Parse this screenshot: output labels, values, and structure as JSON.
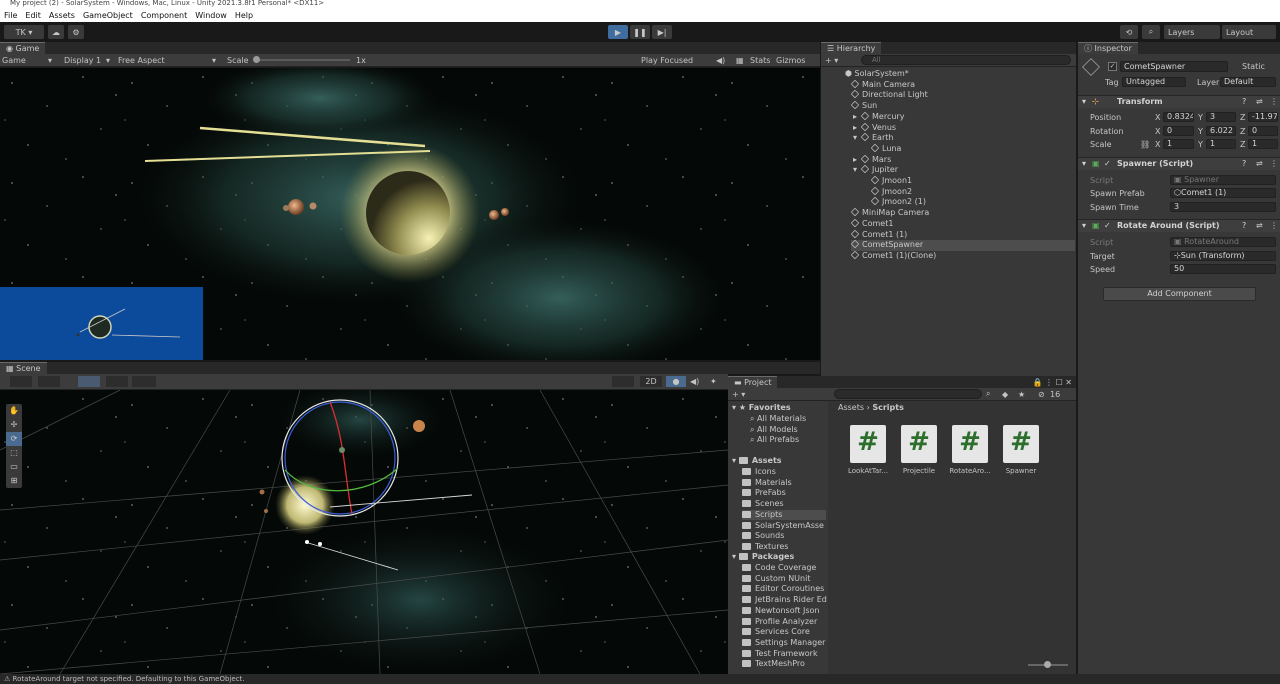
{
  "window": {
    "title": "My project (2) - SolarSystem - Windows, Mac, Linux - Unity 2021.3.8f1 Personal* <DX11>"
  },
  "menu": [
    "File",
    "Edit",
    "Assets",
    "GameObject",
    "Component",
    "Window",
    "Help"
  ],
  "toolbar": {
    "account": "TK ▾",
    "layers": "Layers",
    "layout": "Layout"
  },
  "game": {
    "tab": "Game",
    "display_mode": "Game",
    "display": "Display 1",
    "aspect": "Free Aspect",
    "scale_label": "Scale",
    "scale_value": "1x",
    "play_focused": "Play Focused",
    "stats": "Stats",
    "gizmos": "Gizmos"
  },
  "scene": {
    "tab": "Scene",
    "mode_2d": "2D"
  },
  "hierarchy": {
    "tab": "Hierarchy",
    "search_placeholder": "All",
    "root": "SolarSystem*",
    "items": [
      {
        "label": "Main Camera"
      },
      {
        "label": "Directional Light"
      },
      {
        "label": "Sun"
      },
      {
        "label": "Mercury"
      },
      {
        "label": "Venus"
      },
      {
        "label": "Earth"
      },
      {
        "label": "Luna"
      },
      {
        "label": "Mars"
      },
      {
        "label": "Jupiter"
      },
      {
        "label": "Jmoon1"
      },
      {
        "label": "Jmoon2"
      },
      {
        "label": "Jmoon2 (1)"
      },
      {
        "label": "MiniMap Camera"
      },
      {
        "label": "Comet1"
      },
      {
        "label": "Comet1 (1)"
      },
      {
        "label": "CometSpawner"
      },
      {
        "label": "Comet1 (1)(Clone)"
      }
    ]
  },
  "inspector": {
    "tab": "Inspector",
    "object_name": "CometSpawner",
    "static": "Static",
    "tag_label": "Tag",
    "tag_value": "Untagged",
    "layer_label": "Layer",
    "layer_value": "Default",
    "transform": {
      "title": "Transform",
      "position_label": "Position",
      "rotation_label": "Rotation",
      "scale_label": "Scale",
      "x": "X",
      "y": "Y",
      "z": "Z",
      "pos": [
        "0.8324",
        "3",
        "-11.971"
      ],
      "rot": [
        "0",
        "6.022",
        "0"
      ],
      "scl": [
        "1",
        "1",
        "1"
      ]
    },
    "spawner": {
      "title": "Spawner (Script)",
      "script_label": "Script",
      "script_value": "Spawner",
      "prefab_label": "Spawn Prefab",
      "prefab_value": "Comet1 (1)",
      "time_label": "Spawn Time",
      "time_value": "3"
    },
    "rotate": {
      "title": "Rotate Around (Script)",
      "script_label": "Script",
      "script_value": "RotateAround",
      "target_label": "Target",
      "target_value": "Sun (Transform)",
      "speed_label": "Speed",
      "speed_value": "50"
    },
    "add_component": "Add Component"
  },
  "project": {
    "tab": "Project",
    "breadcrumb_root": "Assets",
    "breadcrumb_current": "Scripts",
    "badge_count": "16",
    "favorites_label": "Favorites",
    "favorites": [
      "All Materials",
      "All Models",
      "All Prefabs"
    ],
    "assets_label": "Assets",
    "asset_folders": [
      "Icons",
      "Materials",
      "PreFabs",
      "Scenes",
      "Scripts",
      "SolarSystemAsse"
    ],
    "sounds": "Sounds",
    "textures": "Textures",
    "packages_label": "Packages",
    "packages": [
      "Code Coverage",
      "Custom NUnit",
      "Editor Coroutines",
      "JetBrains Rider Ed",
      "Newtonsoft Json",
      "Profile Analyzer",
      "Services Core",
      "Settings Manager",
      "Test Framework",
      "TextMeshPro"
    ],
    "scripts": [
      "LookAtTar...",
      "Projectile",
      "RotateAro...",
      "Spawner"
    ],
    "script_glyph": "#"
  },
  "status": {
    "message": "RotateAround target not specified. Defaulting to this GameObject."
  }
}
